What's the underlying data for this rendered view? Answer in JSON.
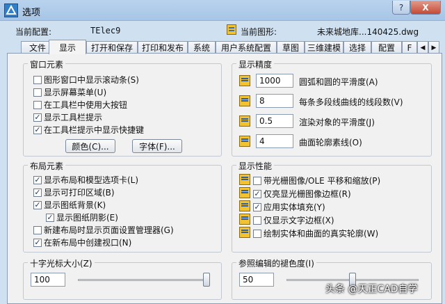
{
  "window": {
    "title": "选项",
    "help": "?",
    "close": "X"
  },
  "config": {
    "current_config_label": "当前配置:",
    "current_config_value": "TElec9",
    "current_drawing_label": "当前图形:",
    "current_drawing_value": "未来城地库...140425.dwg"
  },
  "tabs": [
    "文件",
    "显示",
    "打开和保存",
    "打印和发布",
    "系统",
    "用户系统配置",
    "草图",
    "三维建模",
    "选择",
    "配置",
    "F"
  ],
  "active_tab": "显示",
  "window_elements": {
    "title": "窗口元素",
    "items": [
      {
        "label": "图形窗口中显示滚动条(S)",
        "checked": false
      },
      {
        "label": "显示屏幕菜单(U)",
        "checked": false
      },
      {
        "label": "在工具栏中使用大按钮",
        "checked": false
      },
      {
        "label": "显示工具栏提示",
        "checked": true
      },
      {
        "label": "在工具栏提示中显示快捷键",
        "checked": true
      }
    ],
    "colors_button": "颜色(C)...",
    "fonts_button": "字体(F)..."
  },
  "layout_elements": {
    "title": "布局元素",
    "items": [
      {
        "label": "显示布局和模型选项卡(L)",
        "checked": true
      },
      {
        "label": "显示可打印区域(B)",
        "checked": true
      },
      {
        "label": "显示图纸背景(K)",
        "checked": true
      },
      {
        "label": "显示图纸阴影(E)",
        "checked": true
      },
      {
        "label": "新建布局时显示页面设置管理器(G)",
        "checked": false
      },
      {
        "label": "在新布局中创建视口(N)",
        "checked": true
      }
    ]
  },
  "display_resolution": {
    "title": "显示精度",
    "items": [
      {
        "value": "1000",
        "label": "圆弧和圆的平滑度(A)"
      },
      {
        "value": "8",
        "label": "每条多段线曲线的线段数(V)"
      },
      {
        "value": "0.5",
        "label": "渲染对象的平滑度(J)"
      },
      {
        "value": "4",
        "label": "曲面轮廓素线(O)"
      }
    ]
  },
  "display_performance": {
    "title": "显示性能",
    "items": [
      {
        "label": "带光栅图像/OLE 平移和缩放(P)",
        "checked": false
      },
      {
        "label": "仅亮显光栅图像边框(R)",
        "checked": true
      },
      {
        "label": "应用实体填充(Y)",
        "checked": true
      },
      {
        "label": "仅显示文字边框(X)",
        "checked": false
      },
      {
        "label": "绘制实体和曲面的真实轮廓(W)",
        "checked": false
      }
    ]
  },
  "crosshair": {
    "title": "十字光标大小(Z)",
    "value": "100",
    "fraction": 1.0
  },
  "xref_fade": {
    "title": "参照编辑的褪色度(I)",
    "value": "50",
    "fraction": 0.5
  },
  "watermark": "头条 @天正CAD自学",
  "checkmark": "✓"
}
